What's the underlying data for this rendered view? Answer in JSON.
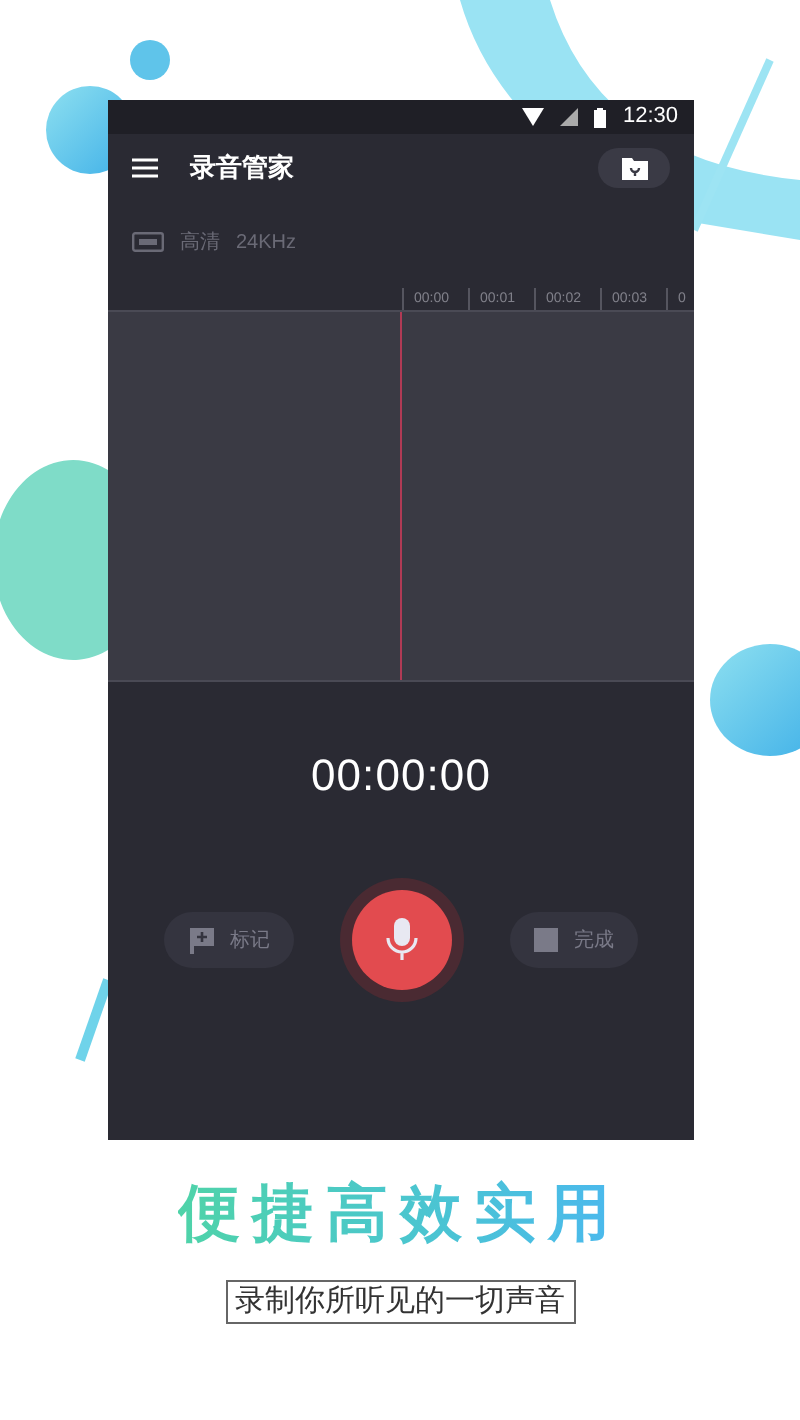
{
  "status_bar": {
    "time": "12:30"
  },
  "app_bar": {
    "title": "录音管家"
  },
  "quality": {
    "label": "高清",
    "rate": "24KHz"
  },
  "timeline": {
    "ticks": [
      "00:00",
      "00:01",
      "00:02",
      "00:03",
      "0"
    ]
  },
  "timer": "00:00:00",
  "controls": [
    {
      "kind": "mark",
      "label": "标记",
      "disabled": true
    },
    {
      "kind": "record"
    },
    {
      "kind": "finish",
      "label": "完成",
      "disabled": true
    }
  ],
  "headline": "便捷高效实用",
  "subtitle": "录制你所听见的一切声音"
}
